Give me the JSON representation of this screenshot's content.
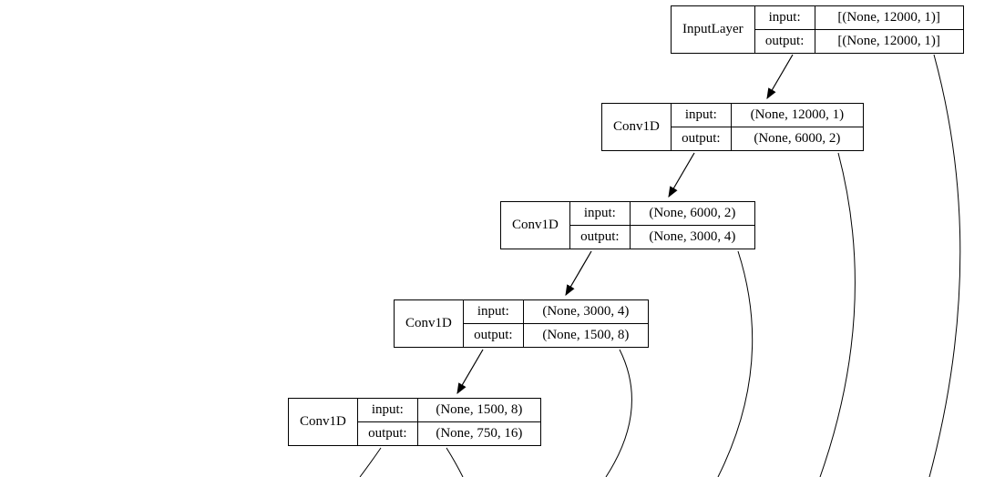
{
  "chart_data": {
    "type": "diagram",
    "description": "Neural network architecture diagram (Keras-style model plot)",
    "nodes": [
      {
        "id": 0,
        "layer_type": "InputLayer",
        "input_shape": "[(None, 12000, 1)]",
        "output_shape": "[(None, 12000, 1)]"
      },
      {
        "id": 1,
        "layer_type": "Conv1D",
        "input_shape": "(None, 12000, 1)",
        "output_shape": "(None, 6000, 2)"
      },
      {
        "id": 2,
        "layer_type": "Conv1D",
        "input_shape": "(None, 6000, 2)",
        "output_shape": "(None, 3000, 4)"
      },
      {
        "id": 3,
        "layer_type": "Conv1D",
        "input_shape": "(None, 3000, 4)",
        "output_shape": "(None, 1500, 8)"
      },
      {
        "id": 4,
        "layer_type": "Conv1D",
        "input_shape": "(None, 1500, 8)",
        "output_shape": "(None, 750, 16)"
      }
    ],
    "edges": [
      {
        "from": 0,
        "to": 1
      },
      {
        "from": 1,
        "to": 2
      },
      {
        "from": 2,
        "to": 3
      },
      {
        "from": 3,
        "to": 4
      }
    ]
  },
  "labels": {
    "input": "input:",
    "output": "output:"
  },
  "nodes": [
    {
      "type": "InputLayer",
      "in": "[(None, 12000, 1)]",
      "out": "[(None, 12000, 1)]"
    },
    {
      "type": "Conv1D",
      "in": "(None, 12000, 1)",
      "out": "(None, 6000, 2)"
    },
    {
      "type": "Conv1D",
      "in": "(None, 6000, 2)",
      "out": "(None, 3000, 4)"
    },
    {
      "type": "Conv1D",
      "in": "(None, 3000, 4)",
      "out": "(None, 1500, 8)"
    },
    {
      "type": "Conv1D",
      "in": "(None, 1500, 8)",
      "out": "(None, 750, 16)"
    }
  ]
}
